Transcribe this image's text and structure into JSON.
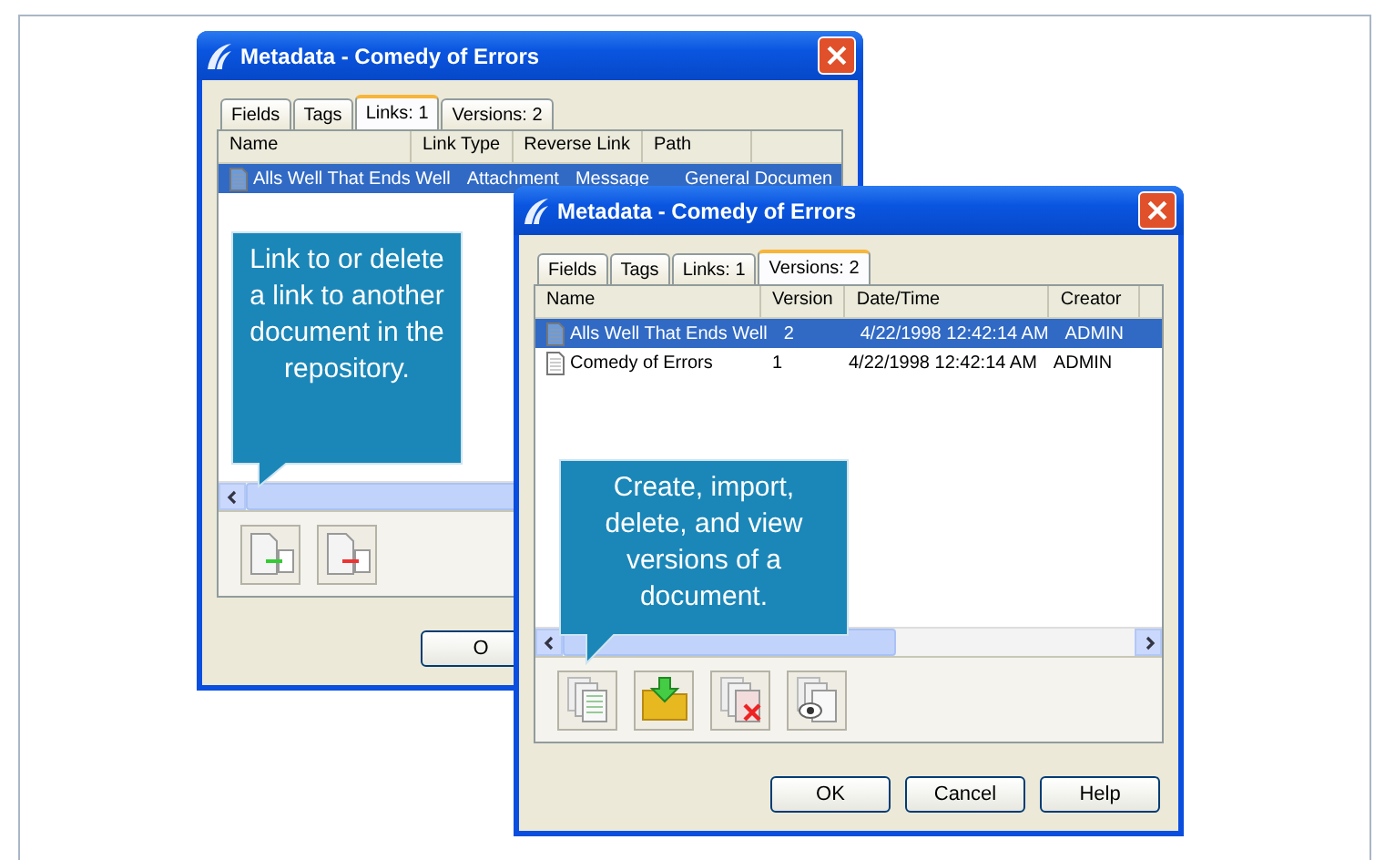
{
  "windows": [
    {
      "title": "Metadata - Comedy of Errors",
      "tabs": [
        {
          "label": "Fields",
          "selected": false
        },
        {
          "label": "Tags",
          "selected": false
        },
        {
          "label": "Links: 1",
          "selected": true
        },
        {
          "label": "Versions: 2",
          "selected": false
        }
      ],
      "columns": [
        "Name",
        "Link Type",
        "Reverse Link",
        "Path"
      ],
      "rows": [
        {
          "selected": true,
          "cells": [
            "Alls Well That Ends Well",
            "Attachment",
            "Message",
            "General Documen"
          ]
        }
      ],
      "tools": [
        {
          "kind": "link-add"
        },
        {
          "kind": "link-remove"
        }
      ],
      "buttons": [
        "O"
      ],
      "callout": "Link to or delete a link to another document in the repository."
    },
    {
      "title": "Metadata - Comedy of Errors",
      "tabs": [
        {
          "label": "Fields",
          "selected": false
        },
        {
          "label": "Tags",
          "selected": false
        },
        {
          "label": "Links: 1",
          "selected": false
        },
        {
          "label": "Versions: 2",
          "selected": true
        }
      ],
      "columns": [
        "Name",
        "Version",
        "Date/Time",
        "Creator"
      ],
      "rows": [
        {
          "selected": true,
          "cells": [
            "Alls Well That Ends Well",
            "2",
            "4/22/1998 12:42:14 AM",
            "ADMIN"
          ]
        },
        {
          "selected": false,
          "cells": [
            "Comedy of Errors",
            "1",
            "4/22/1998 12:42:14 AM",
            "ADMIN"
          ]
        }
      ],
      "tools": [
        {
          "kind": "create"
        },
        {
          "kind": "import"
        },
        {
          "kind": "delete"
        },
        {
          "kind": "view"
        }
      ],
      "buttons": [
        "OK",
        "Cancel",
        "Help"
      ],
      "callout": "Create, import, delete, and view versions of a document."
    }
  ]
}
